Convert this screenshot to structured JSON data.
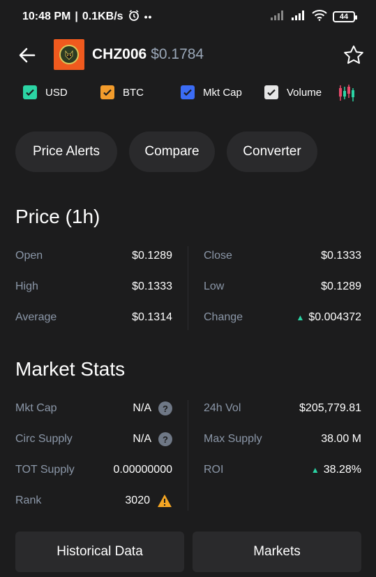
{
  "status_bar": {
    "time": "10:48 PM",
    "speed": "0.1KB/s",
    "dots": "••",
    "battery": "44"
  },
  "header": {
    "symbol": "CHZ006",
    "price": "$0.1784",
    "logo_color": "#f05a1e"
  },
  "toggles": [
    {
      "label": "USD",
      "color": "#2bd4a4",
      "checked": true
    },
    {
      "label": "BTC",
      "color": "#f39c2c",
      "checked": true
    },
    {
      "label": "Mkt Cap",
      "color": "#3b6cf5",
      "checked": true
    },
    {
      "label": "Volume",
      "color": "#e6e6e6",
      "checked": true
    }
  ],
  "actions": {
    "price_alerts": "Price Alerts",
    "compare": "Compare",
    "converter": "Converter"
  },
  "price": {
    "title": "Price (1h)",
    "left": [
      {
        "label": "Open",
        "value": "$0.1289"
      },
      {
        "label": "High",
        "value": "$0.1333"
      },
      {
        "label": "Average",
        "value": "$0.1314"
      }
    ],
    "right": [
      {
        "label": "Close",
        "value": "$0.1333"
      },
      {
        "label": "Low",
        "value": "$0.1289"
      },
      {
        "label": "Change",
        "value": "$0.004372"
      }
    ]
  },
  "market": {
    "title": "Market Stats",
    "left": [
      {
        "label": "Mkt Cap",
        "value": "N/A"
      },
      {
        "label": "Circ Supply",
        "value": "N/A"
      },
      {
        "label": "TOT Supply",
        "value": "0.00000000"
      },
      {
        "label": "Rank",
        "value": "3020"
      }
    ],
    "right": [
      {
        "label": "24h Vol",
        "value": "$205,779.81"
      },
      {
        "label": "Max Supply",
        "value": "38.00 M"
      },
      {
        "label": "ROI",
        "value": "38.28%"
      }
    ]
  },
  "bottom": {
    "historical": "Historical Data",
    "markets": "Markets"
  },
  "colors": {
    "background": "#1c1c1d",
    "button": "#2a2a2c",
    "label": "#8b97a8",
    "positive": "#2bd4a4",
    "warning": "#f5a623"
  }
}
